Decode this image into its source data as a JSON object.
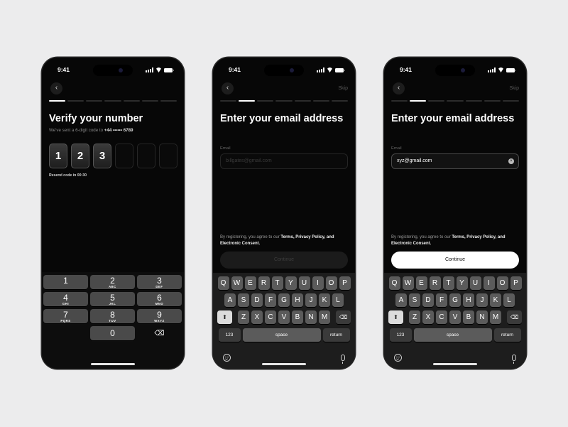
{
  "status": {
    "time": "9:41"
  },
  "screen1": {
    "title": "Verify your number",
    "subtitle_prefix": "We've sent a 6-digit code to",
    "phone": "+44 •••••• 6789",
    "otp": [
      "1",
      "2",
      "3",
      "",
      "",
      ""
    ],
    "resend": "Resend code in 00:30",
    "progress_active_step": 1,
    "progress_total": 7,
    "numpad": [
      {
        "digit": "1",
        "letters": ""
      },
      {
        "digit": "2",
        "letters": "ABC"
      },
      {
        "digit": "3",
        "letters": "DEF"
      },
      {
        "digit": "4",
        "letters": "GHI"
      },
      {
        "digit": "5",
        "letters": "JKL"
      },
      {
        "digit": "6",
        "letters": "MNO"
      },
      {
        "digit": "7",
        "letters": "PQRS"
      },
      {
        "digit": "8",
        "letters": "TUV"
      },
      {
        "digit": "9",
        "letters": "WXYZ"
      },
      {
        "digit": "0",
        "letters": ""
      }
    ],
    "delete_icon": "backspace-icon"
  },
  "screen2": {
    "skip": "Skip",
    "title": "Enter your email address",
    "field_label": "Email",
    "placeholder": "billgates@gmail.com",
    "legal_prefix": "By registering, you agree to our",
    "legal_link1": "Terms, Privacy Policy,",
    "legal_and": "and",
    "legal_link2": "Electronic Consent.",
    "cta": "Continue",
    "cta_enabled": false,
    "progress_active_step": 2
  },
  "screen3": {
    "skip": "Skip",
    "title": "Enter your email address",
    "field_label": "Email",
    "value": "xyz@gmail.com",
    "legal_prefix": "By registering, you agree to our",
    "legal_link1": "Terms, Privacy Policy,",
    "legal_and": "and",
    "legal_link2": "Electronic Consent.",
    "cta": "Continue",
    "cta_enabled": true,
    "progress_active_step": 2
  },
  "keyboard": {
    "row1": [
      "Q",
      "W",
      "E",
      "R",
      "T",
      "Y",
      "U",
      "I",
      "O",
      "P"
    ],
    "row2": [
      "A",
      "S",
      "D",
      "F",
      "G",
      "H",
      "J",
      "K",
      "L"
    ],
    "row3": [
      "Z",
      "X",
      "C",
      "V",
      "B",
      "N",
      "M"
    ],
    "numbers_key": "123",
    "space_key": "space",
    "return_key": "return",
    "shift_icon": "shift-icon",
    "delete_icon": "backspace-icon",
    "emoji_icon": "emoji-icon",
    "mic_icon": "microphone-icon"
  }
}
